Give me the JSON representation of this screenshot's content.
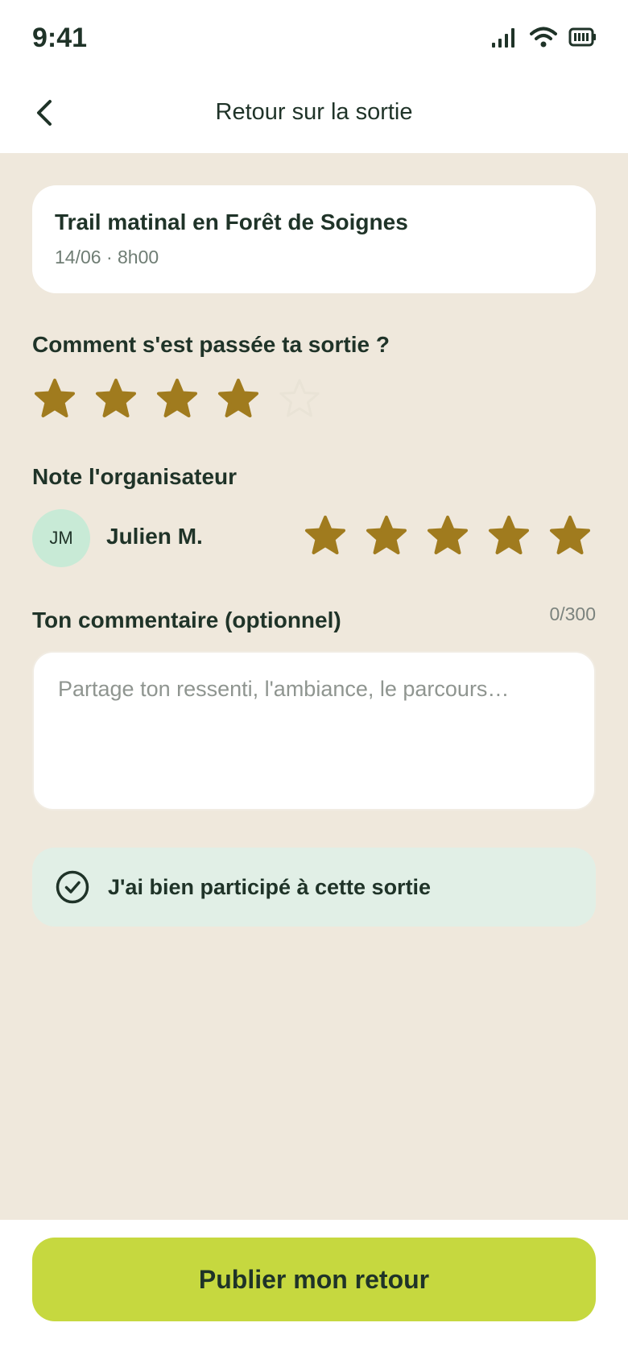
{
  "status_bar": {
    "time": "9:41"
  },
  "header": {
    "title": "Retour sur la sortie"
  },
  "outing": {
    "title": "Trail matinal en Forêt de Soignes",
    "meta": "14/06 · 8h00"
  },
  "outing_rating": {
    "question": "Comment s'est passée ta sortie ?",
    "stars_filled": 4,
    "stars_total": 5
  },
  "organizer_rating": {
    "label": "Note l'organisateur",
    "initials": "JM",
    "name": "Julien M.",
    "stars_filled": 5,
    "stars_total": 5
  },
  "comment": {
    "label": "Ton commentaire (optionnel)",
    "counter": "0/300",
    "placeholder": "Partage ton ressenti, l'ambiance, le parcours…"
  },
  "participation": {
    "label": "J'ai bien participé à cette sortie"
  },
  "publish": {
    "label": "Publier mon retour"
  },
  "colors": {
    "star_filled": "#a07b1e",
    "star_empty": "#e9e3d6",
    "accent": "#c6d83f"
  }
}
